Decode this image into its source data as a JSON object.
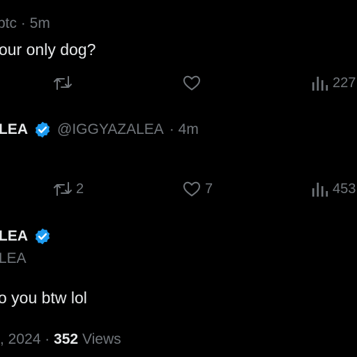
{
  "post1": {
    "handle_tail": "btc",
    "time": "· 5m",
    "text": "our only dog?",
    "actions": {
      "views": "227"
    }
  },
  "post2": {
    "name_tail": "LEA",
    "handle": "@IGGYAZALEA",
    "time": "· 4m",
    "actions": {
      "reposts": "2",
      "likes": "7",
      "views": "453"
    }
  },
  "post3": {
    "name_tail": "LEA",
    "handle_tail": "LEA",
    "text": "o you btw lol",
    "date_tail": ", 2024",
    "sep": "·",
    "views_count": "352",
    "views_label": "Views"
  },
  "colors": {
    "verified": "#1d9bf0",
    "muted": "#71767b",
    "text": "#e7e9ea"
  },
  "icons": [
    "repost-icon",
    "heart-icon",
    "analytics-icon",
    "verified-badge-icon"
  ]
}
